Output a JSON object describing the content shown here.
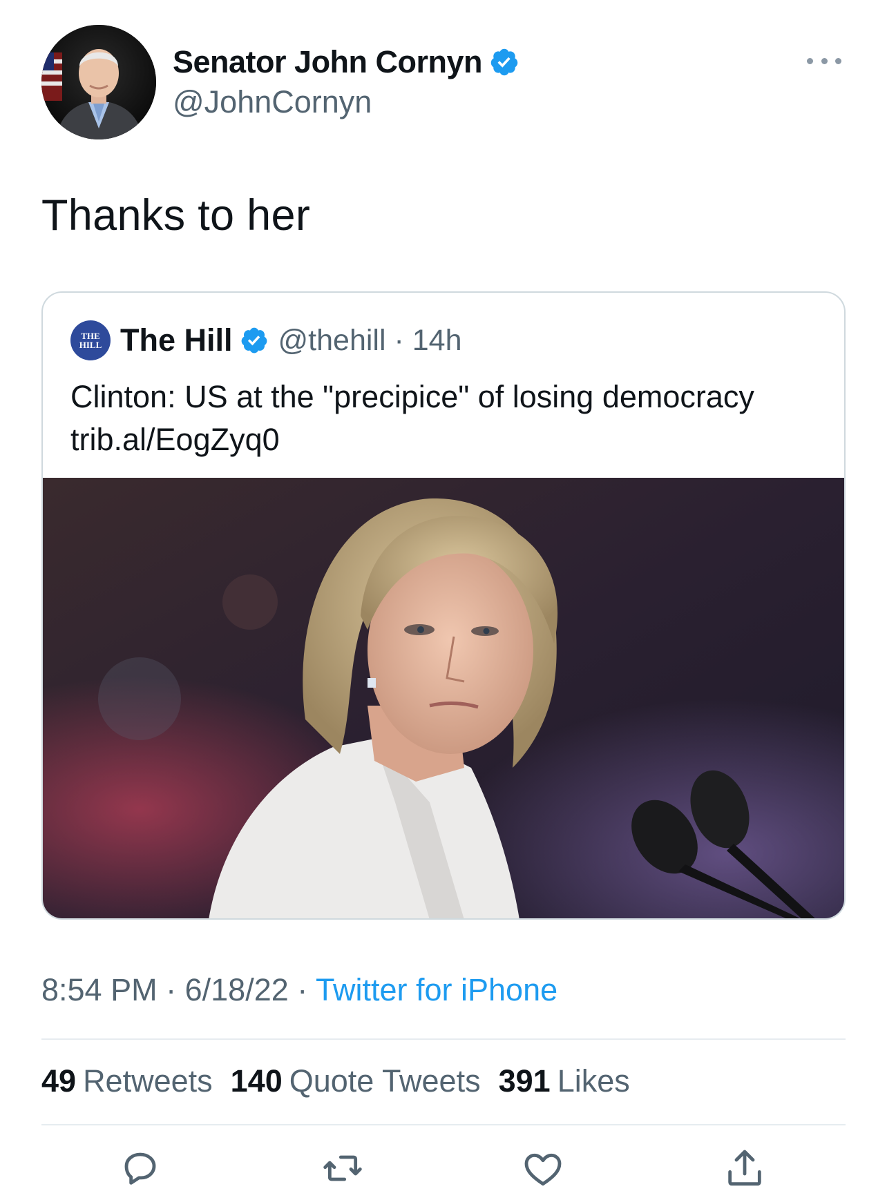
{
  "author": {
    "name": "Senator John Cornyn",
    "handle": "@JohnCornyn",
    "verified": true
  },
  "tweet": {
    "text": "Thanks to her"
  },
  "quoted": {
    "name": "The Hill",
    "handle": "@thehill",
    "separator": "·",
    "time": "14h",
    "logo_line1": "THE",
    "logo_line2": "HILL",
    "text_line1": "Clinton: US at the \"precipice\" of losing democracy",
    "text_line2": "trib.al/EogZyq0"
  },
  "meta": {
    "time": "8:54 PM",
    "sep1": "·",
    "date": "6/18/22",
    "sep2": "·",
    "source": "Twitter for iPhone"
  },
  "stats": {
    "retweets_count": "49",
    "retweets_label": "Retweets",
    "quotes_count": "140",
    "quotes_label": "Quote Tweets",
    "likes_count": "391",
    "likes_label": "Likes"
  },
  "colors": {
    "accent": "#1d9bf0",
    "secondary_text": "#536471",
    "divider": "#e6ecf0"
  },
  "icons": [
    "verified-badge-icon",
    "more-icon",
    "reply-icon",
    "retweet-icon",
    "like-icon",
    "share-icon"
  ]
}
